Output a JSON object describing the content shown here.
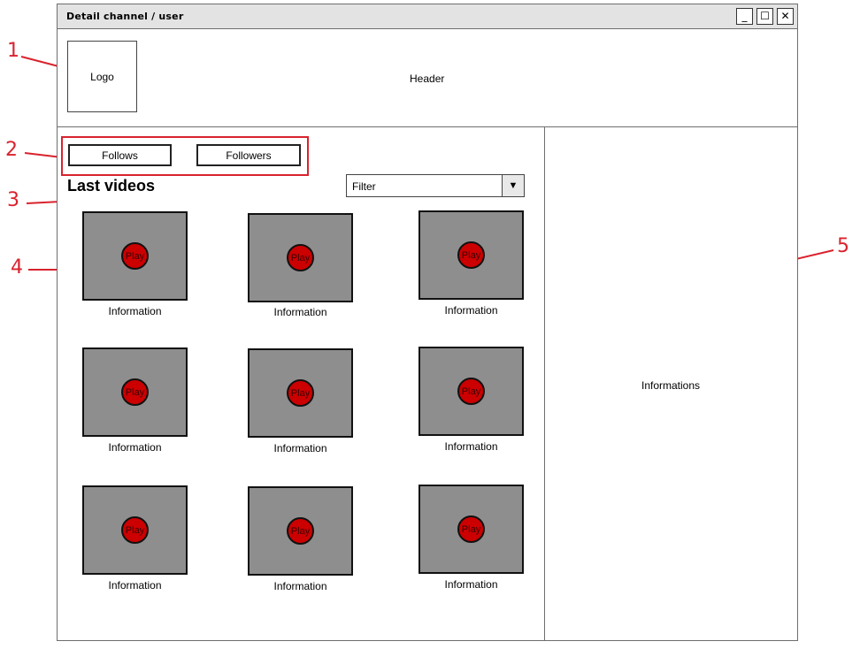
{
  "window": {
    "title": "Detail channel / user",
    "controls": {
      "minimize": "_",
      "maximize": "☐",
      "close": "✕"
    }
  },
  "header": {
    "logo": "Logo",
    "text": "Header"
  },
  "nav": {
    "follows": "Follows",
    "followers": "Followers"
  },
  "videos": {
    "heading": "Last videos",
    "filter": "Filter",
    "filter_arrow": "▼",
    "items": [
      {
        "play": "Play",
        "info": "Information"
      },
      {
        "play": "Play",
        "info": "Information"
      },
      {
        "play": "Play",
        "info": "Information"
      },
      {
        "play": "Play",
        "info": "Information"
      },
      {
        "play": "Play",
        "info": "Information"
      },
      {
        "play": "Play",
        "info": "Information"
      },
      {
        "play": "Play",
        "info": "Information"
      },
      {
        "play": "Play",
        "info": "Information"
      },
      {
        "play": "Play",
        "info": "Information"
      }
    ]
  },
  "side": {
    "text": "Informations"
  },
  "annotations": [
    "1",
    "2",
    "3",
    "4",
    "5"
  ],
  "colors": {
    "annotation": "#d9232e",
    "play": "#cc0000",
    "thumbnail": "#8e8e8e"
  }
}
